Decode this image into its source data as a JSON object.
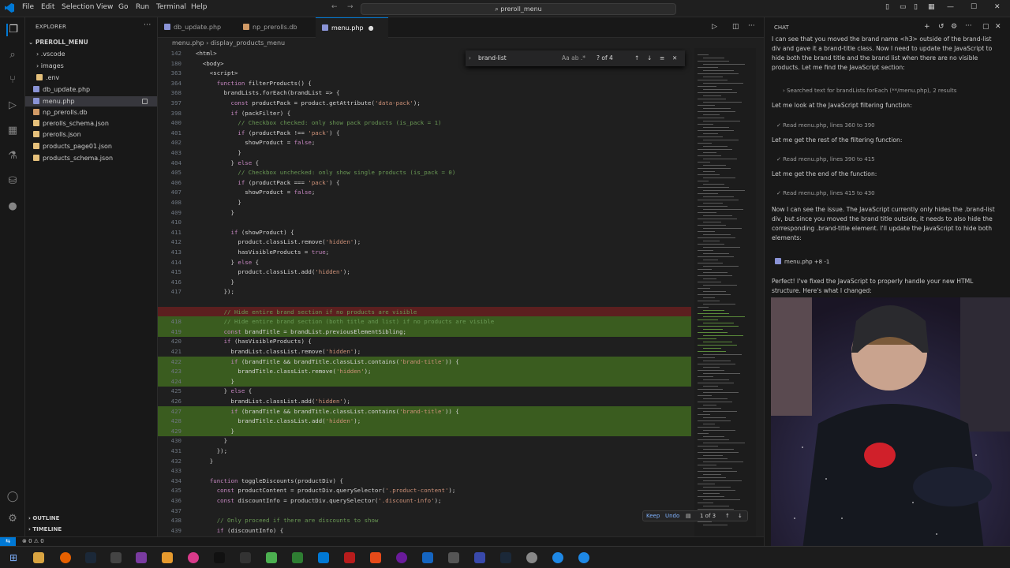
{
  "window": {
    "title": "preroll_menu"
  },
  "menubar": [
    "File",
    "Edit",
    "Selection",
    "View",
    "Go",
    "Run",
    "Terminal",
    "Help"
  ],
  "explorer": {
    "header": "EXPLORER",
    "root": "PREROLL_MENU",
    "items": [
      {
        "label": ".vscode",
        "kind": "folder"
      },
      {
        "label": "images",
        "kind": "folder"
      },
      {
        "label": ".env",
        "kind": "file"
      },
      {
        "label": "db_update.php",
        "kind": "php"
      },
      {
        "label": "menu.php",
        "kind": "php",
        "selected": true
      },
      {
        "label": "np_prerolls.db",
        "kind": "db"
      },
      {
        "label": "prerolls_schema.json",
        "kind": "json"
      },
      {
        "label": "prerolls.json",
        "kind": "json"
      },
      {
        "label": "products_page01.json",
        "kind": "json"
      },
      {
        "label": "products_schema.json",
        "kind": "json"
      }
    ],
    "outline": "OUTLINE",
    "timeline": "TIMELINE"
  },
  "tabs": [
    {
      "label": "db_update.php",
      "active": false
    },
    {
      "label": "np_prerolls.db",
      "active": false
    },
    {
      "label": "menu.php",
      "active": true
    }
  ],
  "breadcrumb": [
    "menu.php",
    "display_products_menu"
  ],
  "find": {
    "query": "brand-list",
    "count": "? of 4",
    "opts": "Aa ab .*"
  },
  "code_lines": [
    {
      "n": "142",
      "t": "<html>"
    },
    {
      "n": "180",
      "t": "  <body>"
    },
    {
      "n": "363",
      "t": "    <script>"
    },
    {
      "n": "364",
      "t": "      function filterProducts() {"
    },
    {
      "n": "368",
      "t": "        brandLists.forEach(brandList => {"
    },
    {
      "n": "397",
      "t": "          const productPack = product.getAttribute('data-pack');"
    },
    {
      "n": "398",
      "t": "          if (packFilter) {"
    },
    {
      "n": "400",
      "t": "            // Checkbox checked: only show pack products (is_pack = 1)"
    },
    {
      "n": "401",
      "t": "            if (productPack !== 'pack') {"
    },
    {
      "n": "402",
      "t": "              showProduct = false;"
    },
    {
      "n": "403",
      "t": "            }"
    },
    {
      "n": "404",
      "t": "          } else {"
    },
    {
      "n": "405",
      "t": "            // Checkbox unchecked: only show single products (is_pack = 0)"
    },
    {
      "n": "406",
      "t": "            if (productPack === 'pack') {"
    },
    {
      "n": "407",
      "t": "              showProduct = false;"
    },
    {
      "n": "408",
      "t": "            }"
    },
    {
      "n": "409",
      "t": "          }"
    },
    {
      "n": "410",
      "t": ""
    },
    {
      "n": "411",
      "t": "          if (showProduct) {"
    },
    {
      "n": "412",
      "t": "            product.classList.remove('hidden');"
    },
    {
      "n": "413",
      "t": "            hasVisibleProducts = true;"
    },
    {
      "n": "414",
      "t": "          } else {"
    },
    {
      "n": "415",
      "t": "            product.classList.add('hidden');"
    },
    {
      "n": "416",
      "t": "          }"
    },
    {
      "n": "417",
      "t": "        });"
    },
    {
      "n": "",
      "t": ""
    },
    {
      "n": "",
      "t": "        // Hide entire brand section if no products are visible",
      "diff": "del"
    },
    {
      "n": "418",
      "t": "        // Hide entire brand section (both title and list) if no products are visible",
      "diff": "add"
    },
    {
      "n": "419",
      "t": "        const brandTitle = brandList.previousElementSibling;",
      "diff": "add"
    },
    {
      "n": "420",
      "t": "        if (hasVisibleProducts) {"
    },
    {
      "n": "421",
      "t": "          brandList.classList.remove('hidden');"
    },
    {
      "n": "422",
      "t": "          if (brandTitle && brandTitle.classList.contains('brand-title')) {",
      "diff": "add"
    },
    {
      "n": "423",
      "t": "            brandTitle.classList.remove('hidden');",
      "diff": "add"
    },
    {
      "n": "424",
      "t": "          }",
      "diff": "add"
    },
    {
      "n": "425",
      "t": "        } else {"
    },
    {
      "n": "426",
      "t": "          brandList.classList.add('hidden');"
    },
    {
      "n": "427",
      "t": "          if (brandTitle && brandTitle.classList.contains('brand-title')) {",
      "diff": "add"
    },
    {
      "n": "428",
      "t": "            brandTitle.classList.add('hidden');",
      "diff": "add"
    },
    {
      "n": "429",
      "t": "          }",
      "diff": "add"
    },
    {
      "n": "430",
      "t": "        }"
    },
    {
      "n": "431",
      "t": "      });"
    },
    {
      "n": "432",
      "t": "    }"
    },
    {
      "n": "433",
      "t": ""
    },
    {
      "n": "434",
      "t": "    function toggleDiscounts(productDiv) {"
    },
    {
      "n": "435",
      "t": "      const productContent = productDiv.querySelector('.product-content');"
    },
    {
      "n": "436",
      "t": "      const discountInfo = productDiv.querySelector('.discount-info');"
    },
    {
      "n": "437",
      "t": ""
    },
    {
      "n": "438",
      "t": "      // Only proceed if there are discounts to show"
    },
    {
      "n": "439",
      "t": "      if (discountInfo) {"
    }
  ],
  "inline_actions": {
    "keep": "Keep",
    "undo": "Undo",
    "counter": "1 of 3"
  },
  "status": {
    "errors": "⊗ 0 ⚠ 0"
  },
  "chat": {
    "header": "CHAT",
    "messages": [
      {
        "t": "I can see that you moved the brand name <h3> outside of the brand-list div and gave it a brand-title class. Now I need to update the JavaScript to hide both the brand title and the brand list when there are no visible products. Let me find the JavaScript section:"
      },
      {
        "t": "Searched text for brandLists.forEach (**/menu.php), 2 results",
        "kind": "tool"
      },
      {
        "t": "Let me look at the JavaScript filtering function:"
      },
      {
        "t": "Read  menu.php, lines 360 to 390",
        "kind": "tool"
      },
      {
        "t": "Let me get the rest of the filtering function:"
      },
      {
        "t": "Read  menu.php, lines 390 to 415",
        "kind": "tool"
      },
      {
        "t": "Let me get the end of the function:"
      },
      {
        "t": "Read  menu.php, lines 415 to 430",
        "kind": "tool"
      },
      {
        "t": "Now I can see the issue. The JavaScript currently only hides the .brand-list div, but since you moved the brand title outside, it needs to also hide the corresponding .brand-title element. I'll update the JavaScript to hide both elements:"
      },
      {
        "t": "menu.php +8 -1",
        "kind": "file"
      },
      {
        "t": "Perfect! I've fixed the JavaScript to properly handle your new HTML structure. Here's what I changed:"
      }
    ]
  }
}
